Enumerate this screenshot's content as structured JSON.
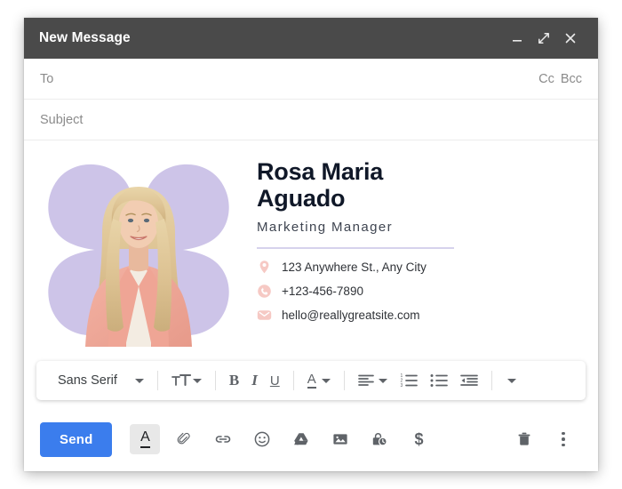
{
  "window": {
    "title": "New Message",
    "controls": [
      {
        "name": "minimize-button",
        "icon": "minimize-icon"
      },
      {
        "name": "expand-button",
        "icon": "expand-diagonal-icon"
      },
      {
        "name": "close-button",
        "icon": "close-icon"
      }
    ]
  },
  "fields": {
    "to_placeholder": "To",
    "cc_label": "Cc",
    "bcc_label": "Bcc",
    "subject_placeholder": "Subject"
  },
  "signature": {
    "name": "Rosa Maria Aguado",
    "name_line1": "Rosa Maria",
    "name_line2": "Aguado",
    "role": "Marketing Manager",
    "contacts": [
      {
        "icon": "location-pin-icon",
        "text": "123 Anywhere St., Any City"
      },
      {
        "icon": "phone-icon",
        "text": "+123-456-7890"
      },
      {
        "icon": "envelope-icon",
        "text": "hello@reallygreatsite.com"
      }
    ],
    "colors": {
      "petal_purple": "#cdc4e8",
      "divider_purple": "#d6d2ec",
      "contact_icon_pink": "#f6c9c4",
      "blazer_pink": "#f0a99a"
    }
  },
  "format_toolbar": {
    "font_family_value": "Sans Serif",
    "items": [
      {
        "name": "font-family-dropdown",
        "label": "Sans Serif",
        "icon": "chevron-down-icon"
      },
      {
        "name": "font-size-button",
        "icon": "font-size-icon"
      },
      {
        "name": "bold-button",
        "icon": "bold-icon",
        "label": "B"
      },
      {
        "name": "italic-button",
        "icon": "italic-icon",
        "label": "I"
      },
      {
        "name": "underline-button",
        "icon": "underline-icon",
        "label": "U"
      },
      {
        "name": "text-color-button",
        "icon": "text-color-icon",
        "label": "A"
      },
      {
        "name": "align-button",
        "icon": "align-left-icon"
      },
      {
        "name": "numbered-list-button",
        "icon": "numbered-list-icon"
      },
      {
        "name": "bulleted-list-button",
        "icon": "bulleted-list-icon"
      },
      {
        "name": "indent-button",
        "icon": "indent-decrease-icon"
      },
      {
        "name": "more-format-button",
        "icon": "chevron-down-icon"
      }
    ]
  },
  "action_bar": {
    "send_label": "Send",
    "send_color": "#3b7ded",
    "buttons": [
      {
        "name": "formatting-options-button",
        "icon": "text-format-a-icon",
        "active": true
      },
      {
        "name": "attach-file-button",
        "icon": "paperclip-icon"
      },
      {
        "name": "insert-link-button",
        "icon": "link-icon"
      },
      {
        "name": "insert-emoji-button",
        "icon": "emoji-smiley-icon"
      },
      {
        "name": "insert-drive-button",
        "icon": "google-drive-icon"
      },
      {
        "name": "insert-photo-button",
        "icon": "image-icon"
      },
      {
        "name": "confidential-mode-button",
        "icon": "lock-clock-icon"
      },
      {
        "name": "insert-money-button",
        "icon": "dollar-sign-icon"
      }
    ],
    "right_buttons": [
      {
        "name": "discard-draft-button",
        "icon": "trash-icon"
      },
      {
        "name": "more-options-button",
        "icon": "more-vertical-icon"
      }
    ]
  }
}
